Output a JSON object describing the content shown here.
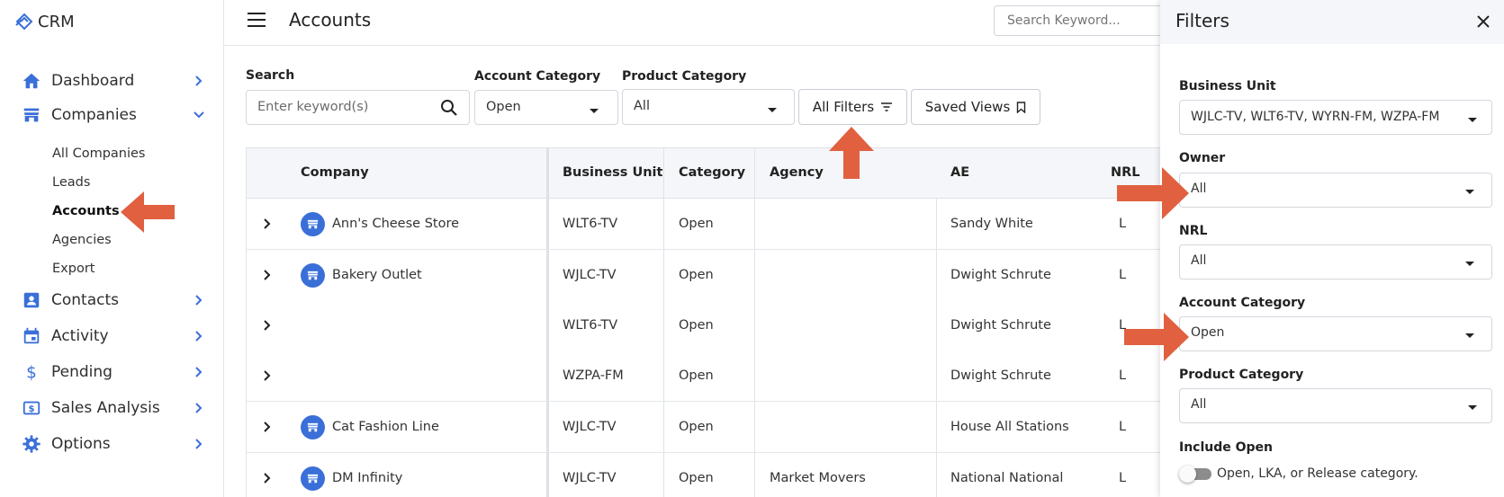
{
  "app": {
    "name": "CRM"
  },
  "colors": {
    "accent": "#3a6fd8",
    "annotation": "#e0603f"
  },
  "sidebar": {
    "items": [
      {
        "label": "Dashboard",
        "icon": "home-icon",
        "expanded": false
      },
      {
        "label": "Companies",
        "icon": "store-icon",
        "expanded": true
      },
      {
        "label": "Contacts",
        "icon": "contact-icon",
        "expanded": false
      },
      {
        "label": "Activity",
        "icon": "calendar-icon",
        "expanded": false
      },
      {
        "label": "Pending",
        "icon": "dollar-icon",
        "expanded": false
      },
      {
        "label": "Sales Analysis",
        "icon": "money-icon",
        "expanded": false
      },
      {
        "label": "Options",
        "icon": "gear-icon",
        "expanded": false
      }
    ],
    "companies_sub": [
      "All Companies",
      "Leads",
      "Accounts",
      "Agencies",
      "Export"
    ],
    "active_sub": "Accounts"
  },
  "header": {
    "title": "Accounts",
    "search_placeholder": "Search Keyword..."
  },
  "filters": {
    "search_label": "Search",
    "search_placeholder": "Enter keyword(s)",
    "account_category_label": "Account Category",
    "account_category_value": "Open",
    "product_category_label": "Product Category",
    "product_category_value": "All",
    "all_filters_label": "All Filters",
    "saved_views_label": "Saved Views"
  },
  "table": {
    "columns": [
      "Company",
      "Business Unit",
      "Category",
      "Agency",
      "AE",
      "NRL"
    ],
    "rows": [
      {
        "company": "Ann's Cheese Store",
        "business_unit": "WLT6-TV",
        "category": "Open",
        "agency": "",
        "ae": "Sandy White",
        "nrl": "L",
        "has_icon": true
      },
      {
        "company": "Bakery Outlet",
        "business_unit": "WJLC-TV",
        "category": "Open",
        "agency": "",
        "ae": "Dwight Schrute",
        "nrl": "L",
        "has_icon": true
      },
      {
        "company": "",
        "business_unit": "WLT6-TV",
        "category": "Open",
        "agency": "",
        "ae": "Dwight Schrute",
        "nrl": "L",
        "has_icon": false
      },
      {
        "company": "",
        "business_unit": "WZPA-FM",
        "category": "Open",
        "agency": "",
        "ae": "Dwight Schrute",
        "nrl": "L",
        "has_icon": false
      },
      {
        "company": "Cat Fashion Line",
        "business_unit": "WJLC-TV",
        "category": "Open",
        "agency": "",
        "ae": "House All Stations",
        "nrl": "L",
        "has_icon": true
      },
      {
        "company": "DM Infinity",
        "business_unit": "WJLC-TV",
        "category": "Open",
        "agency": "Market Movers",
        "ae": "National National",
        "nrl": "L",
        "has_icon": true
      }
    ]
  },
  "panel": {
    "title": "Filters",
    "fields": [
      {
        "label": "Business Unit",
        "value": "WJLC-TV, WLT6-TV, WYRN-FM, WZPA-FM"
      },
      {
        "label": "Owner",
        "value": "All"
      },
      {
        "label": "NRL",
        "value": "All"
      },
      {
        "label": "Account Category",
        "value": "Open"
      },
      {
        "label": "Product Category",
        "value": "All"
      }
    ],
    "include_open_label": "Include Open",
    "include_open_text": "Open, LKA, or Release category.",
    "include_open_on": false
  }
}
